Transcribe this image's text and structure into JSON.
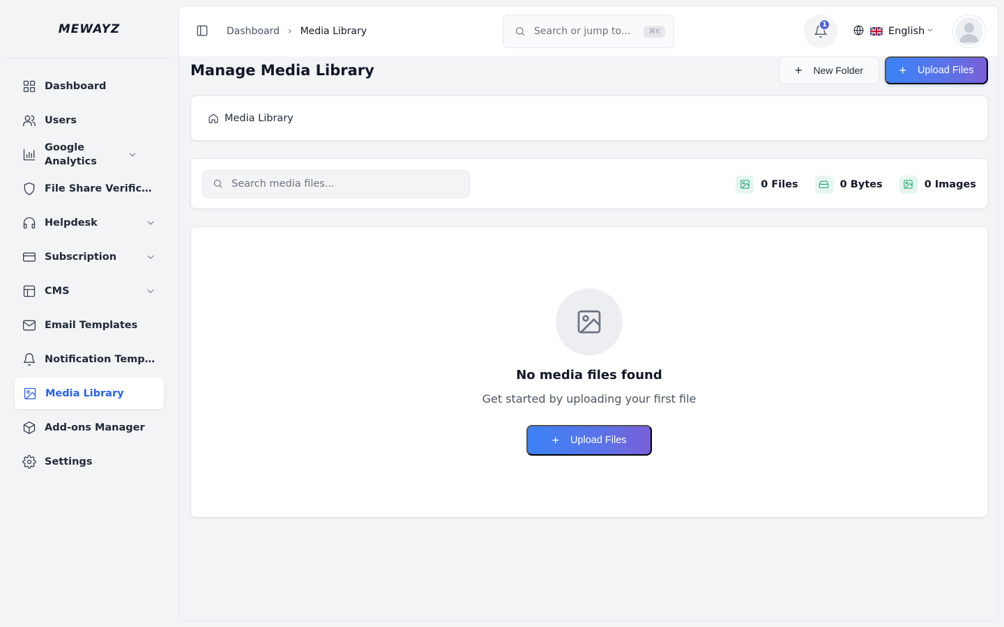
{
  "brand": {
    "name": "MEWAYZ"
  },
  "sidebar": {
    "items": [
      {
        "label": "Dashboard",
        "icon": "grid-icon",
        "expandable": false
      },
      {
        "label": "Users",
        "icon": "users-icon",
        "expandable": false
      },
      {
        "label": "Google Analytics",
        "icon": "bar-chart-icon",
        "expandable": true
      },
      {
        "label": "File Share Verifica...",
        "icon": "shield-icon",
        "expandable": false
      },
      {
        "label": "Helpdesk",
        "icon": "headphones-icon",
        "expandable": true
      },
      {
        "label": "Subscription",
        "icon": "credit-card-icon",
        "expandable": true
      },
      {
        "label": "CMS",
        "icon": "layout-icon",
        "expandable": true
      },
      {
        "label": "Email Templates",
        "icon": "mail-icon",
        "expandable": false
      },
      {
        "label": "Notification Templ...",
        "icon": "bell-icon",
        "expandable": false
      },
      {
        "label": "Media Library",
        "icon": "image-icon",
        "expandable": false,
        "active": true
      },
      {
        "label": "Add-ons Manager",
        "icon": "package-icon",
        "expandable": false
      },
      {
        "label": "Settings",
        "icon": "gear-icon",
        "expandable": false
      }
    ]
  },
  "topbar": {
    "breadcrumb": {
      "parent": "Dashboard",
      "separator": "›",
      "current": "Media Library"
    },
    "search": {
      "placeholder": "Search or jump to...",
      "shortcut": "⌘K"
    },
    "notifications": {
      "count": "1"
    },
    "language": {
      "label": "English",
      "flag": "uk-flag"
    }
  },
  "page": {
    "title": "Manage Media Library",
    "new_folder_label": "New Folder",
    "upload_label": "Upload Files",
    "folder_breadcrumb": "Media Library",
    "search_placeholder": "Search media files...",
    "stats": {
      "files": "0 Files",
      "bytes": "0 Bytes",
      "images": "0 Images"
    },
    "empty": {
      "title": "No media files found",
      "subtitle": "Get started by uploading your first file",
      "button_label": "Upload Files"
    }
  },
  "colors": {
    "accent": "#2563eb",
    "gradient_start": "#3b82f6",
    "gradient_end": "#7a5fd8",
    "stat_icon": "#16a36a",
    "badge": "#4f63d9"
  }
}
